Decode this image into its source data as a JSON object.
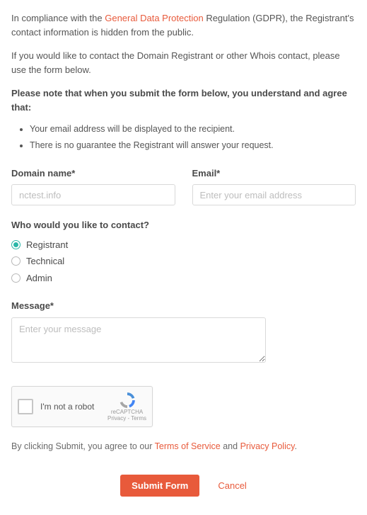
{
  "intro1": {
    "pre": "In compliance with the ",
    "link": "General Data Protection",
    "post": " Regulation (GDPR), the Registrant's contact information is hidden from the public."
  },
  "intro2": "If you would like to contact the Domain Registrant or other Whois contact, please use the form below.",
  "note": "Please note that when you submit the form below, you understand and agree that:",
  "bullets": [
    "Your email address will be displayed to the recipient.",
    "There is no guarantee the Registrant will answer your request."
  ],
  "fields": {
    "domain": {
      "label": "Domain name*",
      "value": "nctest.info"
    },
    "email": {
      "label": "Email*",
      "placeholder": "Enter your email address"
    },
    "contact_question": "Who would you like to contact?",
    "contact_options": [
      "Registrant",
      "Technical",
      "Admin"
    ],
    "contact_selected": 0,
    "message": {
      "label": "Message*",
      "placeholder": "Enter your message"
    }
  },
  "captcha": {
    "text": "I'm not a robot",
    "brand": "reCAPTCHA",
    "terms": "Privacy - Terms"
  },
  "agree": {
    "pre": "By clicking Submit, you agree to our ",
    "tos": "Terms of Service",
    "and": " and ",
    "pp": "Privacy Policy",
    "post": "."
  },
  "actions": {
    "submit": "Submit Form",
    "cancel": "Cancel"
  }
}
